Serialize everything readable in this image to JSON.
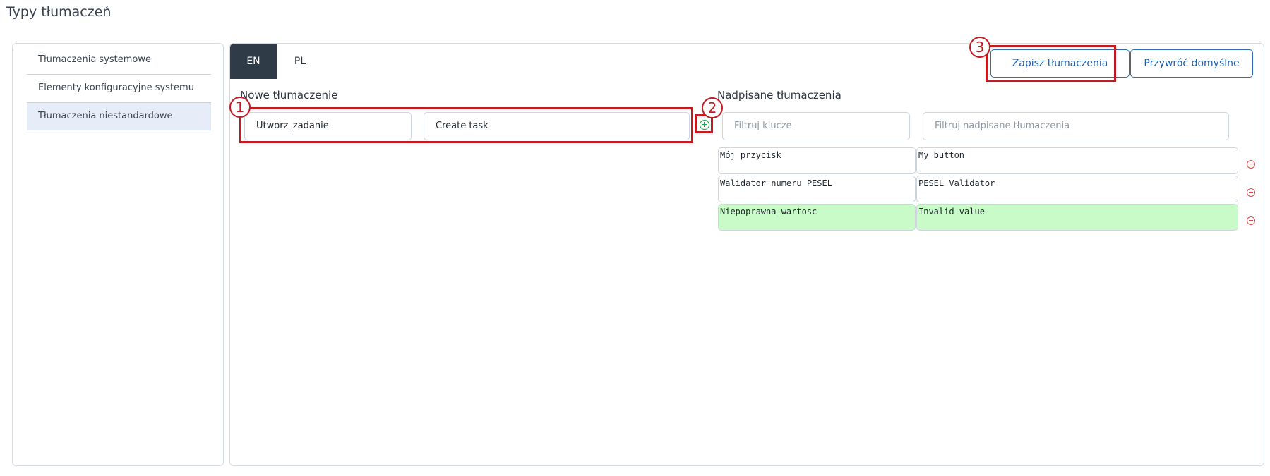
{
  "page_title": "Typy tłumaczeń",
  "sidebar": {
    "items": [
      {
        "label": "Tłumaczenia systemowe"
      },
      {
        "label": "Elementy konfiguracyjne systemu"
      },
      {
        "label": "Tłumaczenia niestandardowe"
      }
    ],
    "active_index": 2
  },
  "tabs": [
    {
      "label": "EN"
    },
    {
      "label": "PL"
    }
  ],
  "active_tab": "EN",
  "buttons": {
    "save_label": "Zapisz tłumaczenia",
    "restore_label": "Przywróć domyślne"
  },
  "new_translation": {
    "title": "Nowe tłumaczenie",
    "key_value": "Utworz_zadanie",
    "value_value": "Create task",
    "add_icon": "plus-circle-icon"
  },
  "overridden": {
    "title": "Nadpisane tłumaczenia",
    "filter_keys_placeholder": "Filtruj klucze",
    "filter_values_placeholder": "Filtruj nadpisane tłumaczenia",
    "rows": [
      {
        "key": "Mój przycisk",
        "value": "My button"
      },
      {
        "key": "Walidator numeru PESEL",
        "value": "PESEL Validator"
      },
      {
        "key": "Niepoprawna_wartosc",
        "value": "Invalid value"
      }
    ],
    "remove_icon": "minus-circle-icon"
  },
  "annotations": [
    "1",
    "2",
    "3"
  ],
  "colors": {
    "accent": "#2f6db5",
    "active_tab_bg": "#2f3b47",
    "annotation": "#c41a22",
    "new_row_bg": "#c9fbc9",
    "remove": "#e0474c",
    "add": "#1aa44a"
  }
}
